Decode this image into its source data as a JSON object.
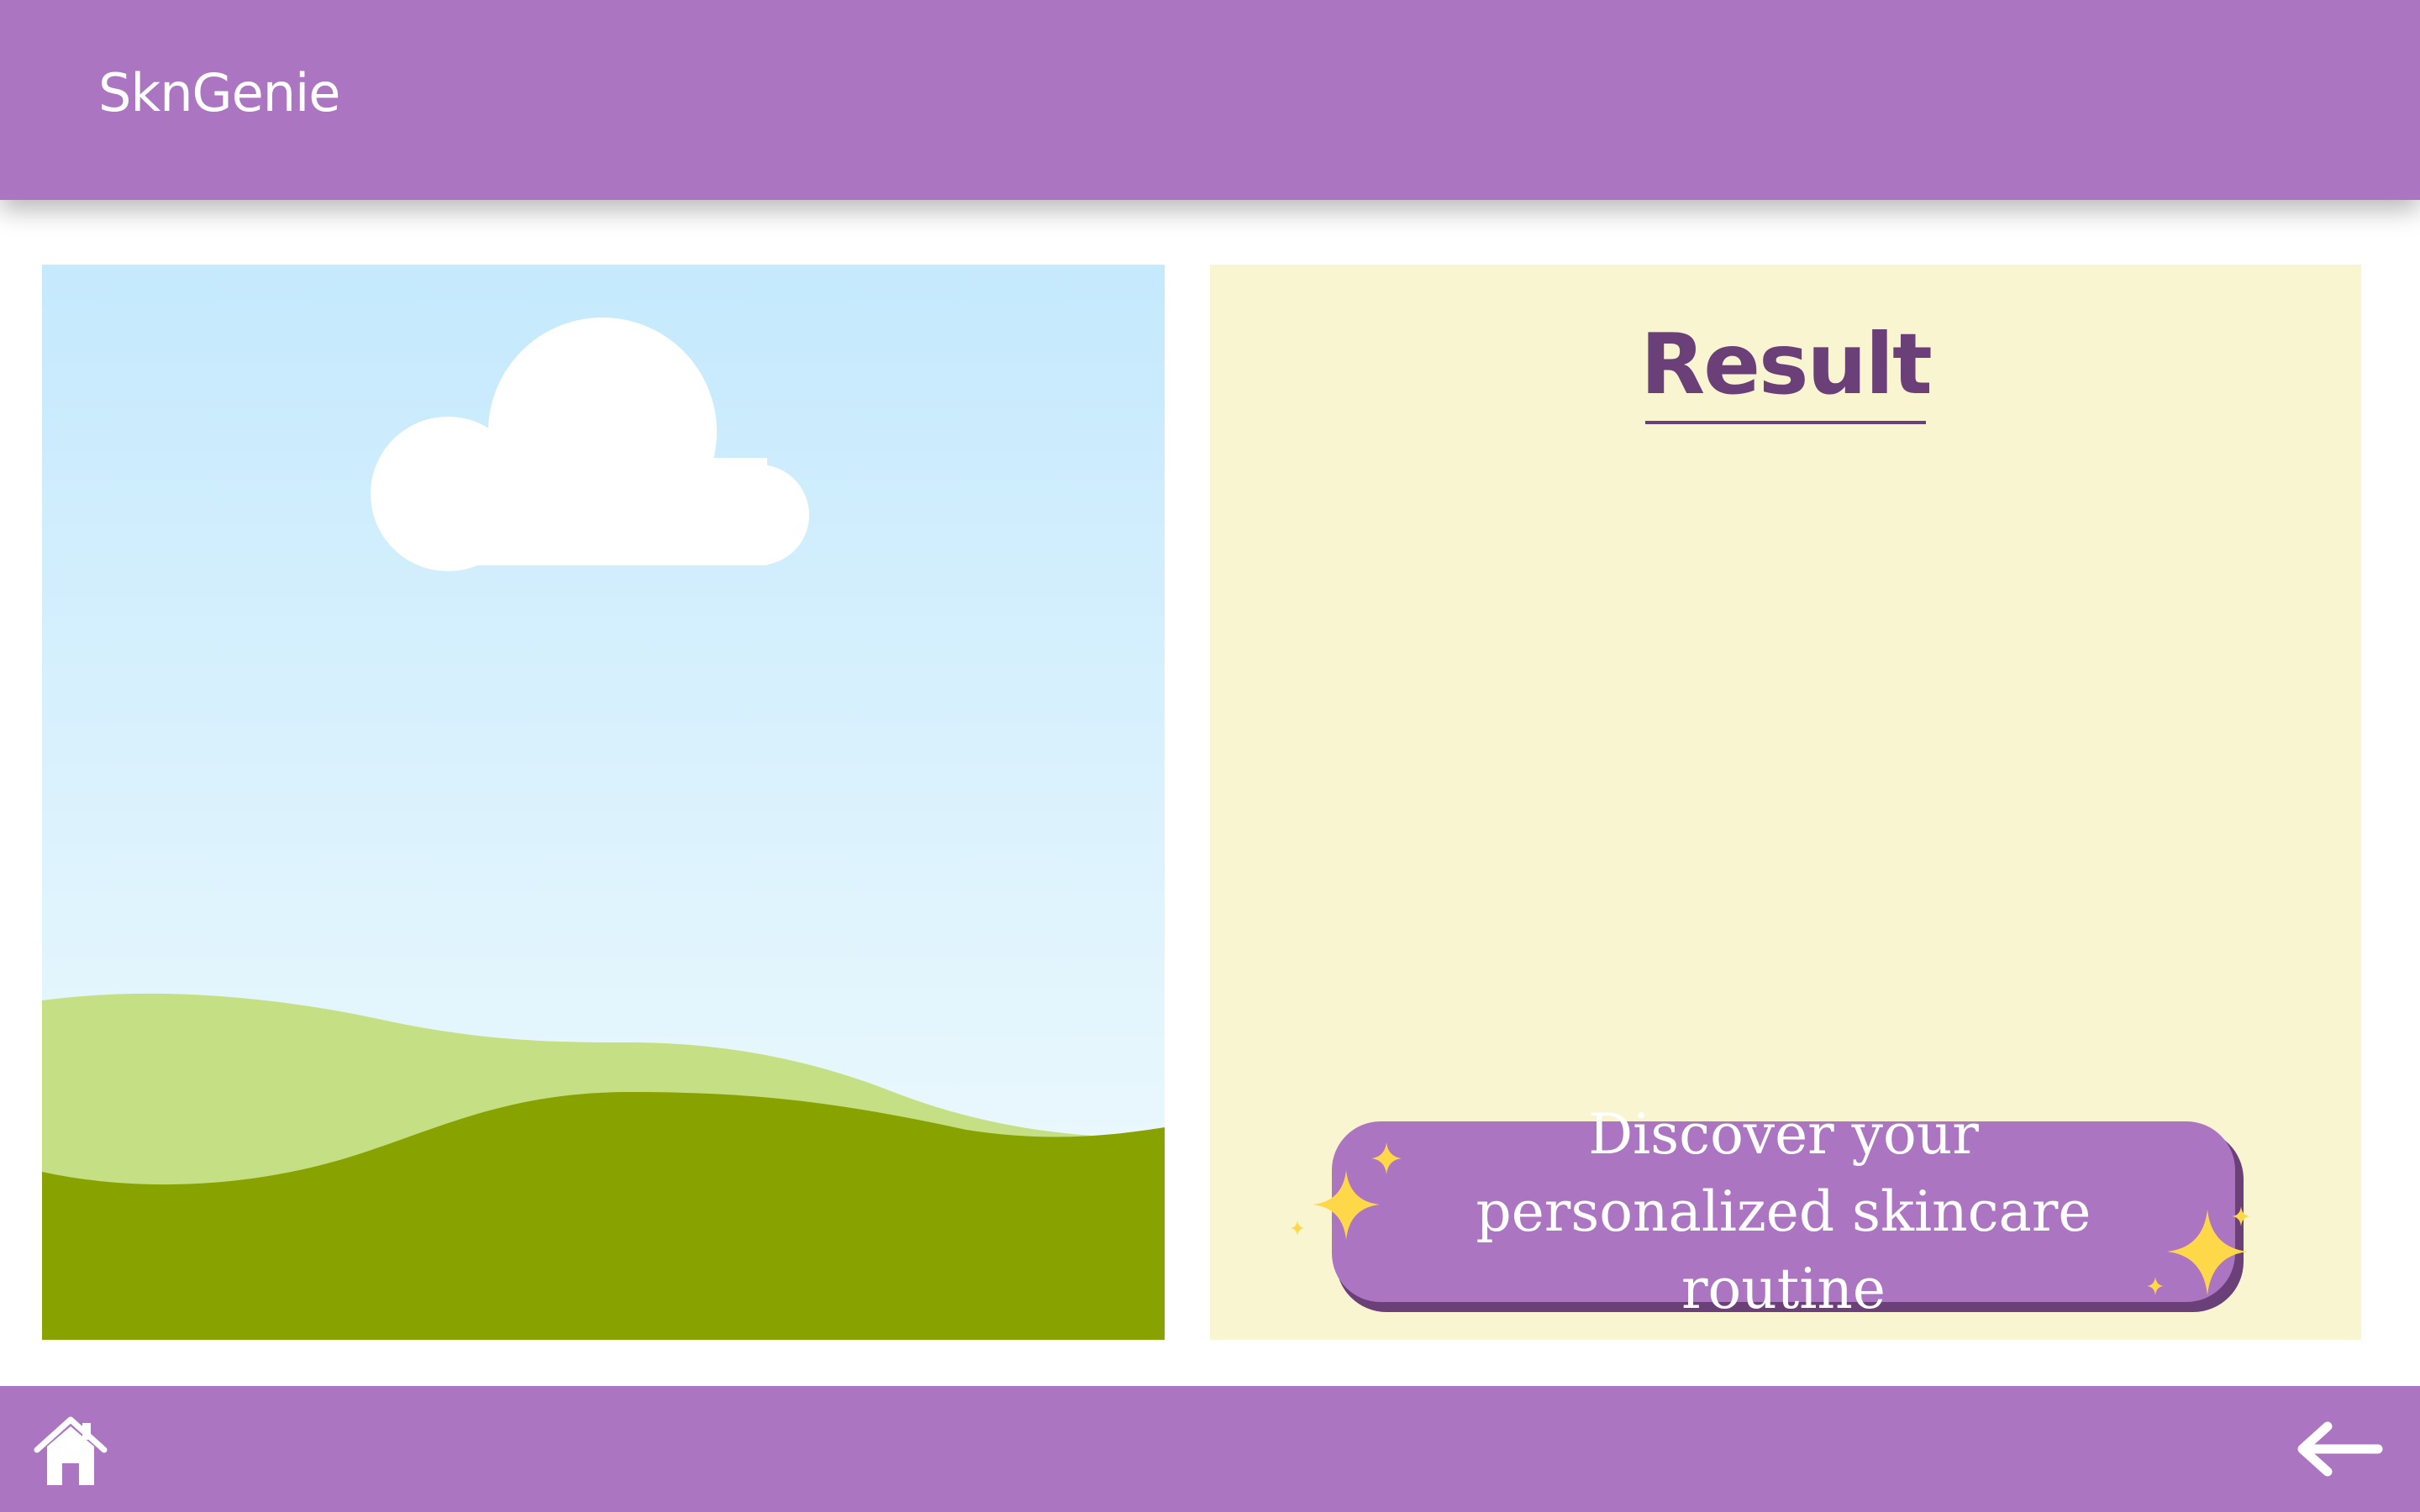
{
  "app": {
    "brand": "SknGenie"
  },
  "result": {
    "title": "Result",
    "cta_label": "Discover your personalized skincare routine"
  },
  "image_panel": {
    "content": "placeholder-landscape-image"
  },
  "nav": {
    "home_icon": "home-icon",
    "back_icon": "back-arrow-icon"
  },
  "colors": {
    "brand_purple": "#ac75c1",
    "dark_purple": "#6b3f78",
    "result_bg": "#faf5d1",
    "sparkle": "#ffd84a",
    "sky_top": "#c5e9fd",
    "sky_bottom": "#f1fbfd",
    "hill_back": "#c5df84",
    "hill_front": "#88a300"
  }
}
